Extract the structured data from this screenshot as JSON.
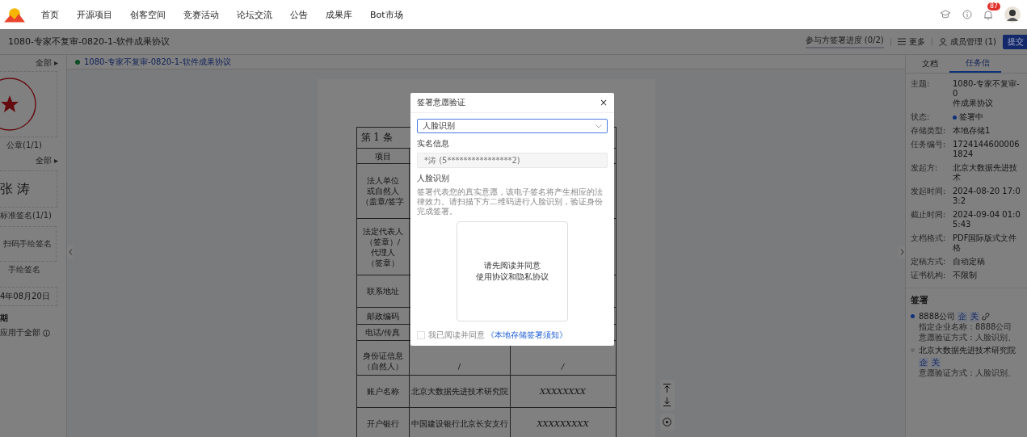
{
  "nav": {
    "items": [
      {
        "label": "首页",
        "selected": false
      },
      {
        "label": "开源项目",
        "selected": false
      },
      {
        "label": "创客空间",
        "selected": false
      },
      {
        "label": "竞赛活动",
        "selected": false
      },
      {
        "label": "论坛交流",
        "selected": false
      },
      {
        "label": "公告",
        "selected": false
      },
      {
        "label": "成果库",
        "selected": false
      },
      {
        "label": "Bot市场",
        "selected": false
      }
    ],
    "badge": "87"
  },
  "header": {
    "title": "1080-专家不复审-0820-1-软件成果协议",
    "progress": "参与方签署进度",
    "progress_count": "(0/2)",
    "more": "更多",
    "members": "成员管理 (1)",
    "submit": "提交"
  },
  "left_panel": {
    "seal_all": "全部 ▸",
    "seal_caption": "公章(1/1)",
    "sign_all": "全部 ▸",
    "signature": "张 涛",
    "sign_caption": "标准签名(1/1)",
    "scan_sign": "扫码手绘签名",
    "hand_sign_caption": "手绘签名",
    "date": "4年08月20日",
    "section": "期",
    "apply_all": "应用于全部"
  },
  "doc_tab": {
    "title": "1080-专家不复审-0820-1-软件成果协议",
    "color": "#0e4d25"
  },
  "table": {
    "heading": "第 1 条",
    "rows": [
      {
        "label": [
          "项目"
        ],
        "cells": []
      },
      {
        "label": [
          "法人单位",
          "或自然人",
          "（盖章/签字"
        ],
        "cells": []
      },
      {
        "label": [
          "法定代表人",
          "（签章）/",
          "代理人",
          "（签章）"
        ],
        "cells": []
      },
      {
        "label": [
          "联系地址"
        ],
        "cells": []
      },
      {
        "label": [
          "邮政编码"
        ],
        "cells": []
      },
      {
        "label": [
          "电话/传真"
        ],
        "cells": []
      },
      {
        "label": [
          "身份证信息",
          "（自然人）"
        ],
        "cells": [
          "/",
          "/"
        ]
      },
      {
        "label": [
          "账户名称"
        ],
        "cells": [
          "北京大数据先进技术研究院",
          "XXXXXXXX"
        ]
      },
      {
        "label": [
          "开户银行"
        ],
        "cells": [
          "中国建设银行北京长安支行",
          "XXXXXXXXX"
        ]
      }
    ]
  },
  "right_panel": {
    "tabs": [
      {
        "label": "文档",
        "selected": false
      },
      {
        "label": "任务信",
        "selected": true
      }
    ],
    "fields": [
      {
        "label": "主题:",
        "value": "1080-专家不复审-0",
        "value2": "件成果协议"
      },
      {
        "label": "状态:",
        "value": "签署中",
        "color": "#10307a"
      },
      {
        "label": "存储类型:",
        "value": "本地存储1"
      },
      {
        "label": "任务编号:",
        "value": "17241446000061824"
      },
      {
        "label": "发起方:",
        "value": "北京大数据先进技术"
      },
      {
        "label": "发起时间:",
        "value": "2024-08-20 17:03:2"
      },
      {
        "label": "截止时间:",
        "value": "2024-09-04 01:05:43"
      },
      {
        "label": "文档格式:",
        "value": "PDF国际版式文件格"
      },
      {
        "label": "定稿方式:",
        "value": "自动定稿"
      },
      {
        "label": "证书机构:",
        "value": "不限制"
      }
    ],
    "signers_title": "签署",
    "signers": [
      {
        "name": "8888公司",
        "tags": [
          "企",
          "关"
        ],
        "link": true,
        "active": true,
        "details": [
          "指定企业名称：8888公司",
          "意愿验证方式：人脸识别、"
        ]
      },
      {
        "name": "北京大数据先进技术研究院",
        "tags": [
          "企",
          "关"
        ],
        "link": false,
        "active": false,
        "details": [
          "意愿验证方式：人脸识别、"
        ]
      }
    ]
  },
  "modal": {
    "title": "签署意愿验证",
    "close": "×",
    "method": "人脸识别",
    "realname_label": "实名信息",
    "realname": "*涛 (5****************2)",
    "face_label": "人脸识别",
    "description": "签署代表您的真实意愿，该电子签名将产生相应的法律效力。请扫描下方二维码进行人脸识别，验证身份完成签署。",
    "qr_lines": [
      "请先阅读并同意",
      "使用协议和隐私协议"
    ],
    "agree_checked": false,
    "agree_text": "我已阅读并同意",
    "agree_link": "《本地存储签署须知》"
  }
}
